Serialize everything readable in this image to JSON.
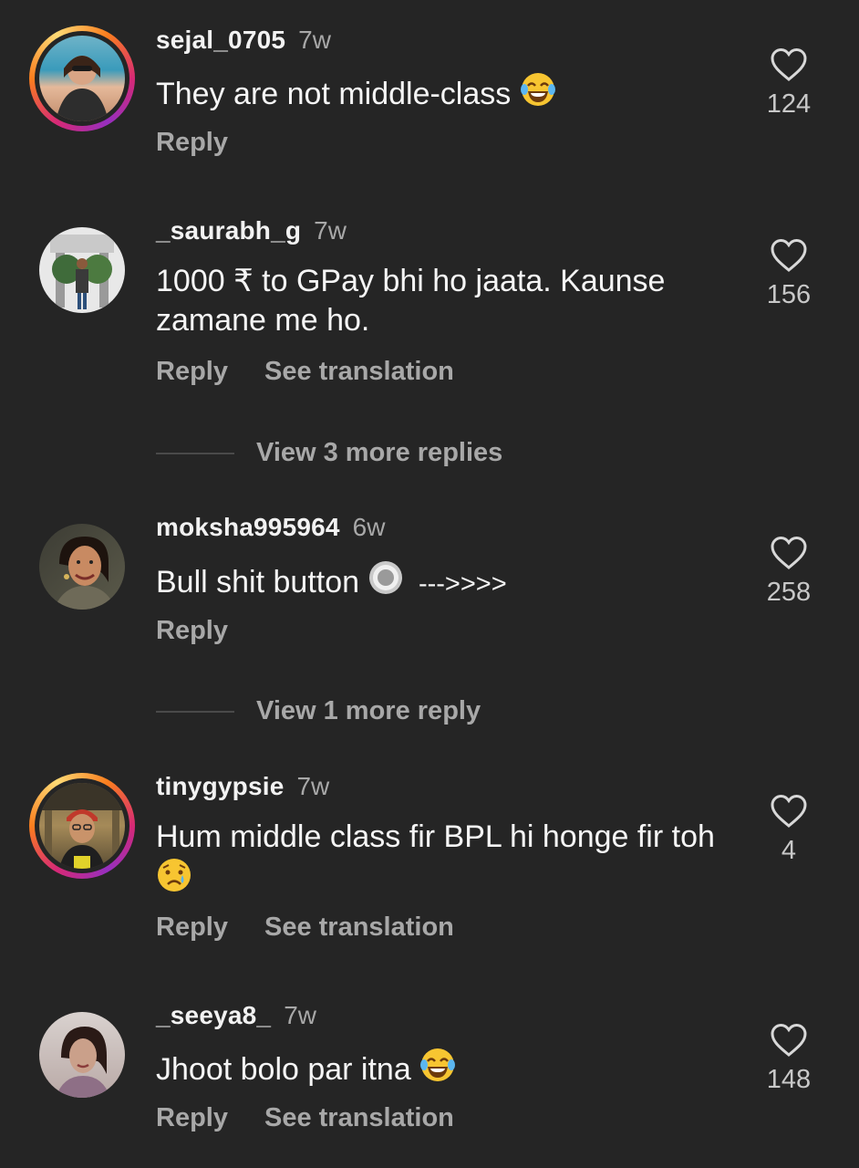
{
  "comments": [
    {
      "username": "sejal_0705",
      "time": "7w",
      "text": "They are not middle-class",
      "emoji": "laughing-tears",
      "likes": "124",
      "actions": [
        "Reply"
      ]
    },
    {
      "username": "_saurabh_g",
      "time": "7w",
      "text": "1000 ₹ to GPay bhi ho jaata. Kaunse zamane me ho.",
      "emoji": "",
      "likes": "156",
      "actions": [
        "Reply",
        "See translation"
      ],
      "view_more": "View 3 more replies"
    },
    {
      "username": "moksha995964",
      "time": "6w",
      "text": "Bull shit button",
      "emoji": "radio-button",
      "text_after": "--->>>>",
      "likes": "258",
      "actions": [
        "Reply"
      ],
      "view_more": "View 1 more reply"
    },
    {
      "username": "tinygypsie",
      "time": "7w",
      "text": "Hum middle class fir BPL hi honge fir toh",
      "emoji": "crying-face",
      "likes": "4",
      "actions": [
        "Reply",
        "See translation"
      ]
    },
    {
      "username": "_seeya8_",
      "time": "7w",
      "text": "Jhoot bolo par itna",
      "emoji": "laughing-tears",
      "likes": "148",
      "actions": [
        "Reply",
        "See translation"
      ]
    }
  ],
  "icons": {
    "like": "heart-outline-icon"
  },
  "colors": {
    "background": "#252525",
    "muted": "#a8a8a8",
    "text": "#f2f2f2"
  }
}
